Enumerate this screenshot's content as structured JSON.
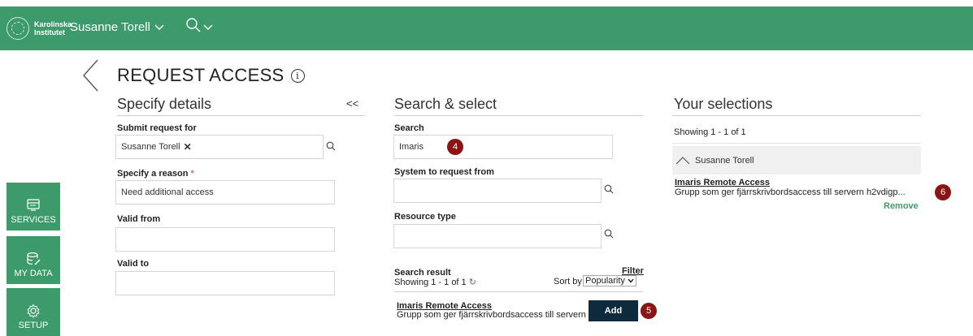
{
  "header": {
    "logo_text": "Karolinska Institutet",
    "user_name": "Susanne Torell",
    "accent_color": "#3d9b6b"
  },
  "page": {
    "title": "REQUEST ACCESS"
  },
  "sidebar": {
    "items": [
      {
        "label": "SERVICES",
        "icon": "services-icon"
      },
      {
        "label": "MY DATA",
        "icon": "database-icon"
      },
      {
        "label": "SETUP",
        "icon": "gear-icon"
      }
    ]
  },
  "details": {
    "heading": "Specify details",
    "collapse_label": "<<",
    "submit_for_label": "Submit request for",
    "submit_for_value": "Susanne Torell",
    "reason_label": "Specify a reason",
    "reason_required": "*",
    "reason_value": "Need additional access",
    "valid_from_label": "Valid from",
    "valid_from_value": "",
    "valid_to_label": "Valid to",
    "valid_to_value": ""
  },
  "search": {
    "heading": "Search & select",
    "search_label": "Search",
    "search_value": "Imaris",
    "system_label": "System to request from",
    "system_value": "",
    "resource_label": "Resource type",
    "resource_value": "",
    "result_label": "Search result",
    "filter_label": "Filter",
    "showing": "Showing 1 - 1 of 1",
    "sort_by_label": "Sort by",
    "sort_value": "Popularity",
    "result_title": "Imaris Remote Access",
    "result_desc": "Grupp som ger fjärrskrivbordsaccess till servern",
    "add_label": "Add"
  },
  "selections": {
    "heading": "Your selections",
    "showing": "Showing 1 - 1 of 1",
    "group_name": "Susanne Torell",
    "item_title": "Imaris Remote Access",
    "item_desc": "Grupp som ger fjärrskrivbordsaccess till servern h2vdigp...",
    "remove_label": "Remove"
  },
  "badges": {
    "b4": "4",
    "b5": "5",
    "b6": "6",
    "color": "#8b1414"
  }
}
